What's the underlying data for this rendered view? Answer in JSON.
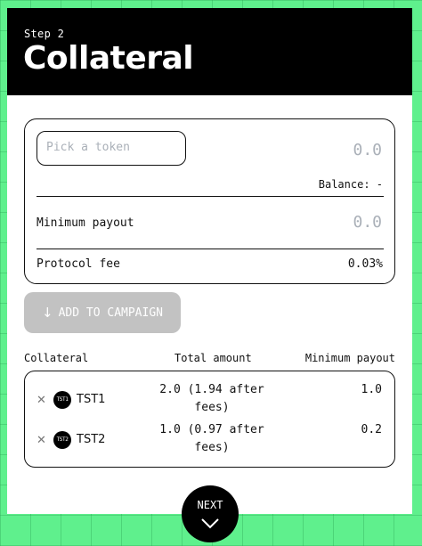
{
  "header": {
    "step": "Step 2",
    "title": "Collateral"
  },
  "form": {
    "token_placeholder": "Pick a token",
    "amount_placeholder": "0.0",
    "balance": "Balance: -",
    "min_payout_label": "Minimum payout",
    "min_payout_placeholder": "0.0",
    "fee_label": "Protocol fee",
    "fee_value": "0.03%"
  },
  "add_button": {
    "label": "ADD TO CAMPAIGN",
    "icon": "arrow-down-icon"
  },
  "table": {
    "columns": [
      "Collateral",
      "Total amount",
      "Minimum payout"
    ],
    "rows": [
      {
        "logo_text": "TST1",
        "token": "TST1",
        "total_line1": "2.0 (1.94 after",
        "total_line2": "fees)",
        "min_payout": "1.0"
      },
      {
        "logo_text": "TST2",
        "token": "TST2",
        "total_line1": "1.0 (0.97 after",
        "total_line2": "fees)",
        "min_payout": "0.2"
      }
    ]
  },
  "next_button": {
    "label": "NEXT",
    "icon": "chevron-down-icon"
  },
  "colors": {
    "background": "#5ff08d",
    "header": "#000000",
    "disabled_button": "#c2c2c2",
    "placeholder": "#aab0b8"
  }
}
